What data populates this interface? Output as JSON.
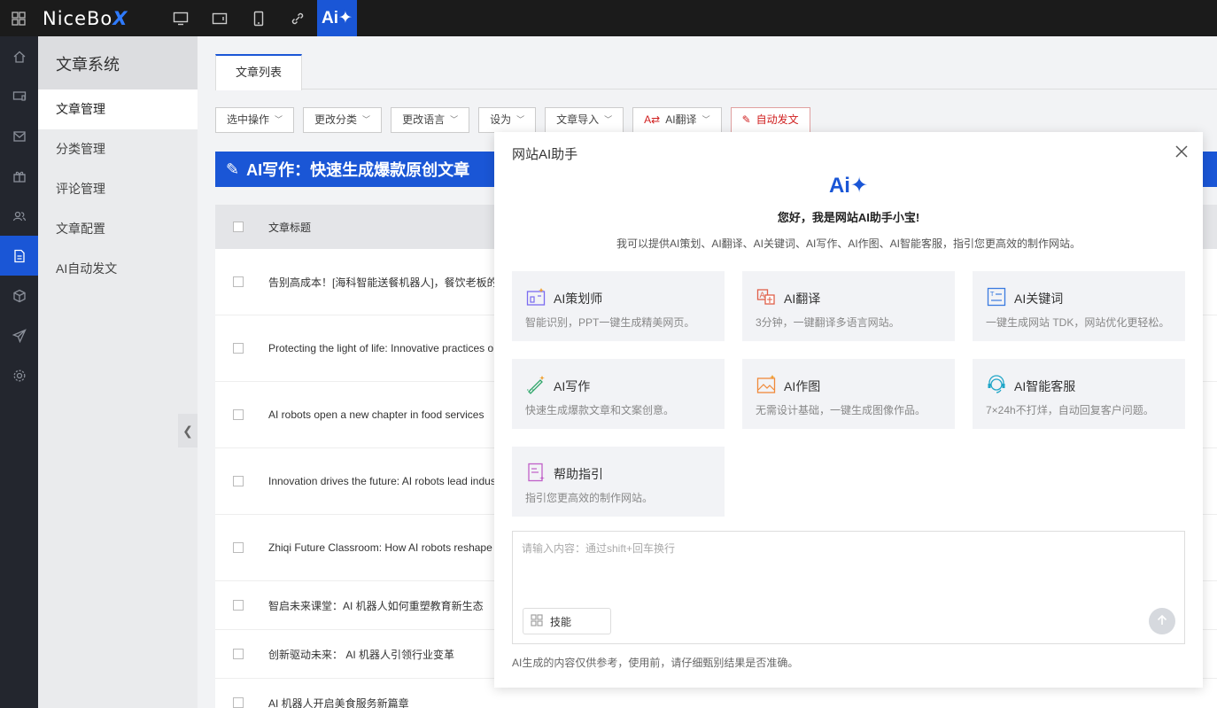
{
  "brand": {
    "logo_main": "NiceBo",
    "logo_x": "X",
    "accent": "#1a56d6"
  },
  "topbar": {
    "icons": [
      "desktop-icon",
      "tablet-icon",
      "mobile-icon",
      "link-icon"
    ],
    "ai_label": "Ai✦"
  },
  "rail": [
    "home-icon",
    "monitor-icon",
    "mail-icon",
    "gift-icon",
    "users-icon",
    "document-icon",
    "box-icon",
    "send-icon",
    "gear-icon"
  ],
  "subside": {
    "title": "文章系统",
    "items": [
      "文章管理",
      "分类管理",
      "评论管理",
      "文章配置",
      "AI自动发文"
    ]
  },
  "main": {
    "tab": "文章列表",
    "toolbar": [
      "选中操作",
      "更改分类",
      "更改语言",
      "设为",
      "文章导入",
      "AI翻译",
      "自动发文"
    ],
    "banner": "AI写作：快速生成爆款原创文章",
    "table_header": "文章标题",
    "rows": [
      "告别高成本！[海科智能送餐机器人]，餐饮老板的",
      "Protecting the light of life: Innovative practices o",
      "AI robots open a new chapter in food services",
      "Innovation drives the future: AI robots lead indus",
      "Zhiqi Future Classroom: How AI robots reshape",
      "智启未来课堂：AI 机器人如何重塑教育新生态",
      "创新驱动未来： AI 机器人引领行业变革",
      "AI 机器人开启美食服务新篇章"
    ]
  },
  "modal": {
    "title": "网站AI助手",
    "logo": "Ai✦",
    "greeting": "您好，我是网站AI助手小宝!",
    "intro": "我可以提供AI策划、AI翻译、AI关键词、AI写作、AI作图、AI智能客服，指引您更高效的制作网站。",
    "cards": [
      {
        "name": "AI策划师",
        "desc": "智能识别，PPT一键生成精美网页。",
        "icon": "planner-icon"
      },
      {
        "name": "AI翻译",
        "desc": "3分钟，一键翻译多语言网站。",
        "icon": "translate-icon"
      },
      {
        "name": "AI关键词",
        "desc": "一键生成网站 TDK，网站优化更轻松。",
        "icon": "keyword-icon"
      },
      {
        "name": "AI写作",
        "desc": "快速生成爆款文章和文案创意。",
        "icon": "writing-icon"
      },
      {
        "name": "AI作图",
        "desc": "无需设计基础，一键生成图像作品。",
        "icon": "image-icon"
      },
      {
        "name": "AI智能客服",
        "desc": "7×24h不打烊，自动回复客户问题。",
        "icon": "headset-icon"
      },
      {
        "name": "帮助指引",
        "desc": "指引您更高效的制作网站。",
        "icon": "guide-icon"
      }
    ],
    "input_placeholder": "请输入内容：通过shift+回车换行",
    "skill_label": "技能",
    "disclaimer": "AI生成的内容仅供参考，使用前，请仔细甄别结果是否准确。"
  }
}
